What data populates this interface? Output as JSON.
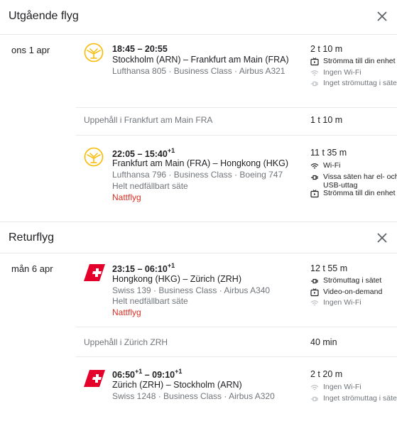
{
  "outbound": {
    "title": "Utgående flyg",
    "date": "ons 1 apr",
    "leg1": {
      "airline": "Lufthansa",
      "times": "18:45 – 20:55",
      "arr_offset": "",
      "route": "Stockholm (ARN) – Frankfurt am Main (FRA)",
      "meta": "Lufthansa 805 · Business Class · Airbus A321",
      "duration": "2 t 10 m",
      "amenities": [
        {
          "icon": "tv-icon",
          "text": "Strömma till din enhet"
        },
        {
          "icon": "wifi-icon",
          "text": "Ingen Wi-Fi"
        },
        {
          "icon": "power-plug-icon",
          "text": "Inget strömuttag i sätet"
        }
      ]
    },
    "layover": {
      "text": "Uppehåll i Frankfurt am Main FRA",
      "duration": "1 t 10 m"
    },
    "leg2": {
      "airline": "Lufthansa",
      "times_dep": "22:05 – 15:40",
      "arr_offset": "+1",
      "route": "Frankfurt am Main (FRA) – Hongkong (HKG)",
      "meta": "Lufthansa 796 · Business Class · Boeing 747",
      "seat": "Helt nedfällbart säte",
      "night": "Nattflyg",
      "duration": "11 t 35 m",
      "amenities": [
        {
          "icon": "wifi-icon",
          "text": "Wi-Fi"
        },
        {
          "icon": "power-plug-icon",
          "text": "Vissa säten har el- och USB-uttag"
        },
        {
          "icon": "tv-icon",
          "text": "Strömma till din enhet"
        }
      ]
    }
  },
  "return": {
    "title": "Returflyg",
    "date": "mån 6 apr",
    "leg1": {
      "airline": "Swiss",
      "times_dep": "23:15 – 06:10",
      "arr_offset": "+1",
      "route": "Hongkong (HKG) – Zürich (ZRH)",
      "meta": "Swiss 139 · Business Class · Airbus A340",
      "seat": "Helt nedfällbart säte",
      "night": "Nattflyg",
      "duration": "12 t 55 m",
      "amenities": [
        {
          "icon": "power-plug-icon",
          "text": "Strömuttag i sätet"
        },
        {
          "icon": "tv-icon",
          "text": "Video-on-demand"
        },
        {
          "icon": "wifi-icon",
          "text": "Ingen Wi-Fi"
        }
      ]
    },
    "layover": {
      "text": "Uppehåll i Zürich ZRH",
      "duration": "40 min"
    },
    "leg2": {
      "airline": "Swiss",
      "dep": "06:50",
      "dep_offset": "+1",
      "arr": "09:10",
      "arr_offset": "+1",
      "route": "Zürich (ZRH) – Stockholm (ARN)",
      "meta": "Swiss 1248 · Business Class · Airbus A320",
      "duration": "2 t 20 m",
      "amenities": [
        {
          "icon": "wifi-icon",
          "text": "Ingen Wi-Fi"
        },
        {
          "icon": "power-plug-icon",
          "text": "Inget strömuttag i sätet"
        }
      ]
    }
  },
  "colors": {
    "lufthansa": "#f9ba00",
    "swiss": "#e4002b",
    "night": "#d93025",
    "muted": "#70757a"
  }
}
